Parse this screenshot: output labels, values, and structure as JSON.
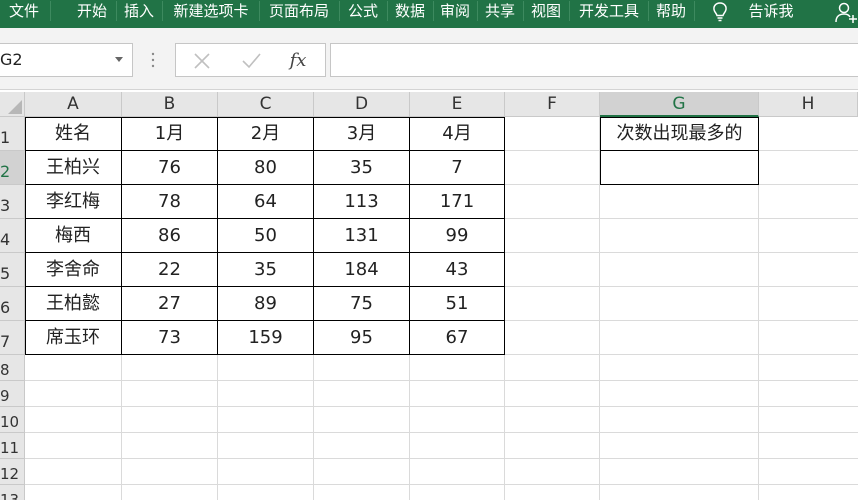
{
  "ribbon": {
    "tabs": [
      "文件",
      "开始",
      "插入",
      "新建选项卡",
      "页面布局",
      "公式",
      "数据",
      "审阅",
      "共享",
      "视图",
      "开发工具",
      "帮助"
    ],
    "tell_me": "告诉我",
    "accent_color": "#217346"
  },
  "formula_bar": {
    "name_box": "G2",
    "cancel_icon": "x-icon",
    "enter_icon": "check-icon",
    "fx": "fx",
    "formula": ""
  },
  "grid": {
    "columns": [
      "A",
      "B",
      "C",
      "D",
      "E",
      "F",
      "G",
      "H"
    ],
    "rows": [
      "1",
      "2",
      "3",
      "4",
      "5",
      "6",
      "7",
      "8",
      "9",
      "10",
      "11",
      "12",
      "13"
    ],
    "selected_cell": "G2"
  },
  "table": {
    "header": [
      "姓名",
      "1月",
      "2月",
      "3月",
      "4月"
    ],
    "rows": [
      [
        "王柏兴",
        "76",
        "80",
        "35",
        "7"
      ],
      [
        "李红梅",
        "78",
        "64",
        "113",
        "171"
      ],
      [
        "梅西",
        "86",
        "50",
        "131",
        "99"
      ],
      [
        "李舍命",
        "22",
        "35",
        "184",
        "43"
      ],
      [
        "王柏懿",
        "27",
        "89",
        "75",
        "51"
      ],
      [
        "席玉环",
        "73",
        "159",
        "95",
        "67"
      ]
    ]
  },
  "g_block": {
    "label": "次数出现最多的",
    "value": ""
  }
}
